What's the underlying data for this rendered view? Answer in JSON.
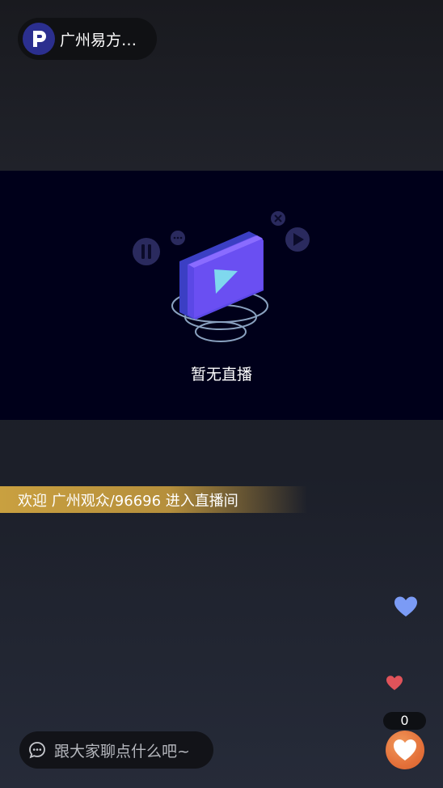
{
  "header": {
    "channel_name": "广州易方…",
    "logo_icon": "p-logo-icon"
  },
  "player": {
    "status_text": "暂无直播",
    "illustration_icon": "video-play-icon"
  },
  "welcome": {
    "message": "欢迎 广州观众/96696 进入直播间"
  },
  "likes": {
    "count": "0",
    "like_icon": "heart-icon"
  },
  "chat": {
    "placeholder": "跟大家聊点什么吧~",
    "icon": "chat-bubble-icon"
  },
  "colors": {
    "player_bg": "#00001a",
    "banner_gold": "#c9a040",
    "like_orange": "#e4713a",
    "heart_blue": "#7b9bf5",
    "heart_red": "#e0535a"
  }
}
